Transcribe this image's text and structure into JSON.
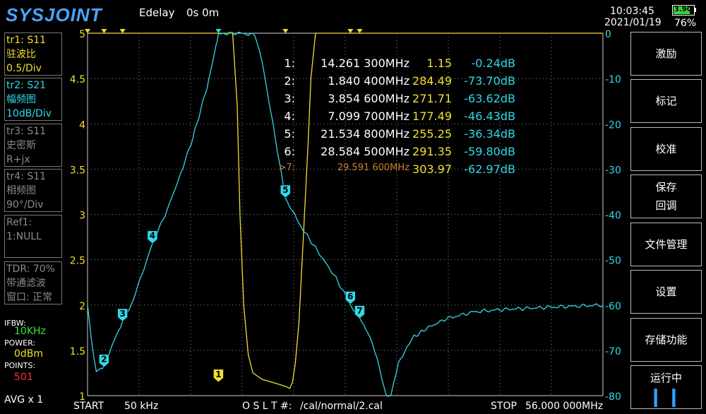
{
  "header": {
    "brand": "SYSJOINT",
    "edelay_label": "Edelay",
    "edelay_value": "0s 0m",
    "time": "10:03:45",
    "date": "2021/01/19",
    "battery_voltage": "3.90V",
    "battery_percent": "76%"
  },
  "traces": [
    {
      "line1": "tr1:  S11",
      "line2": "驻波比",
      "line3": "0.5/Div",
      "color": "#f0e030"
    },
    {
      "line1": "tr2:  S21",
      "line2": "幅频图",
      "line3": "10dB/Div",
      "color": "#30d8e8"
    },
    {
      "line1": "tr3:  S11",
      "line2": "史密斯",
      "line3": "R+jx",
      "color": "#8a8a8a"
    },
    {
      "line1": "tr4:  S11",
      "line2": "相频图",
      "line3": "90°/Div",
      "color": "#8a8a8a"
    },
    {
      "line1": "Ref1:",
      "line2": "1:NULL",
      "line3": "",
      "color": "#8a8a8a"
    },
    {
      "line1": "TDR: 70%",
      "line2": "带通滤波",
      "line3": "窗口: 正常",
      "color": "#8a8a8a"
    }
  ],
  "status": {
    "ifbw_label": "IFBW:",
    "ifbw_value": "10KHz",
    "power_label": "POWER:",
    "power_value": "0dBm",
    "points_label": "POINTS:",
    "points_value": "501",
    "avg": "AVG x 1"
  },
  "menu": [
    {
      "label": "激励"
    },
    {
      "label": "标记"
    },
    {
      "label": "校准"
    },
    {
      "label": "保存\n回调"
    },
    {
      "label": "文件管理"
    },
    {
      "label": "设置"
    },
    {
      "label": "存储功能"
    },
    {
      "label": "运行中"
    }
  ],
  "footer": {
    "start_label": "START",
    "start_value": "50 kHz",
    "cal_label": "O S L T #:",
    "cal_path": "/cal/normal/2.cal",
    "stop_label": "STOP",
    "stop_value": "56.000 000MHz"
  },
  "markers": [
    {
      "id": "1:",
      "freq": "14.261 300MHz",
      "swr": "1.15",
      "db": "-0.24dB"
    },
    {
      "id": "2:",
      "freq": "1.840 400MHz",
      "swr": "284.49",
      "db": "-73.70dB"
    },
    {
      "id": "3:",
      "freq": "3.854 600MHz",
      "swr": "271.71",
      "db": "-63.62dB"
    },
    {
      "id": "4:",
      "freq": "7.099 700MHz",
      "swr": "177.49",
      "db": "-46.43dB"
    },
    {
      "id": "5:",
      "freq": "21.534 800MHz",
      "swr": "255.25",
      "db": "-36.34dB"
    },
    {
      "id": "6:",
      "freq": "28.584 500MHz",
      "swr": "291.35",
      "db": "-59.80dB"
    },
    {
      "id": ">7:",
      "freq": "29.591 600MHz",
      "swr": "303.97",
      "db": "-62.97dB"
    }
  ],
  "chart_data": {
    "type": "line",
    "x_range_mhz": [
      0.05,
      56.0
    ],
    "left_axis": {
      "ticks": [
        "5",
        "4.5",
        "4",
        "3.5",
        "3",
        "2.5",
        "2",
        "1.5",
        "1"
      ],
      "ylim": [
        1,
        5
      ]
    },
    "right_axis": {
      "ticks": [
        "0",
        "-10",
        "-20",
        "-30",
        "-40",
        "-50",
        "-60",
        "-70",
        "-80"
      ],
      "ylim": [
        -80,
        0
      ]
    },
    "marker_labels": [
      "1",
      "2",
      "3",
      "4",
      "5",
      "6",
      "7"
    ],
    "series": [
      {
        "name": "tr1: S11",
        "axis": "left",
        "color": "#f0e030",
        "x": [
          0.05,
          15.8,
          16.3,
          16.6,
          17.0,
          17.5,
          18.0,
          19.0,
          20.0,
          21.0,
          21.6,
          22.0,
          22.3,
          22.6,
          23.0,
          23.5,
          24.0,
          24.3,
          24.8,
          25.6,
          56.0
        ],
        "y": [
          5,
          5,
          4.2,
          3.0,
          2.0,
          1.45,
          1.25,
          1.18,
          1.15,
          1.12,
          1.1,
          1.08,
          1.15,
          1.35,
          1.8,
          2.8,
          3.8,
          4.5,
          5,
          5,
          5
        ]
      },
      {
        "name": "tr2: S21",
        "axis": "right",
        "color": "#30d8e8",
        "x": [
          0.05,
          0.5,
          1.0,
          1.5,
          1.84,
          2.5,
          3.85,
          5.0,
          6.0,
          7.1,
          8.5,
          10.0,
          11.5,
          13.0,
          14.0,
          14.26,
          15.0,
          17.0,
          18.2,
          19.0,
          20.0,
          21.53,
          23.0,
          25.0,
          27.0,
          28.58,
          29.59,
          30.5,
          31.5,
          32.5,
          33.0,
          33.8,
          34.5,
          35.5,
          37.0,
          39.0,
          42.0,
          45.0,
          50.0,
          56.0
        ],
        "y": [
          -60,
          -68,
          -75,
          -74,
          -73.7,
          -70,
          -63.6,
          -59,
          -53,
          -46.4,
          -40,
          -32,
          -23,
          -12,
          -3,
          -0.24,
          0,
          0,
          -0.5,
          -6,
          -18,
          -36.3,
          -42,
          -48,
          -54,
          -59.8,
          -63,
          -66,
          -72,
          -80,
          -80,
          -73,
          -70,
          -67,
          -65,
          -63,
          -61.5,
          -61,
          -60.5,
          -60
        ]
      }
    ]
  }
}
